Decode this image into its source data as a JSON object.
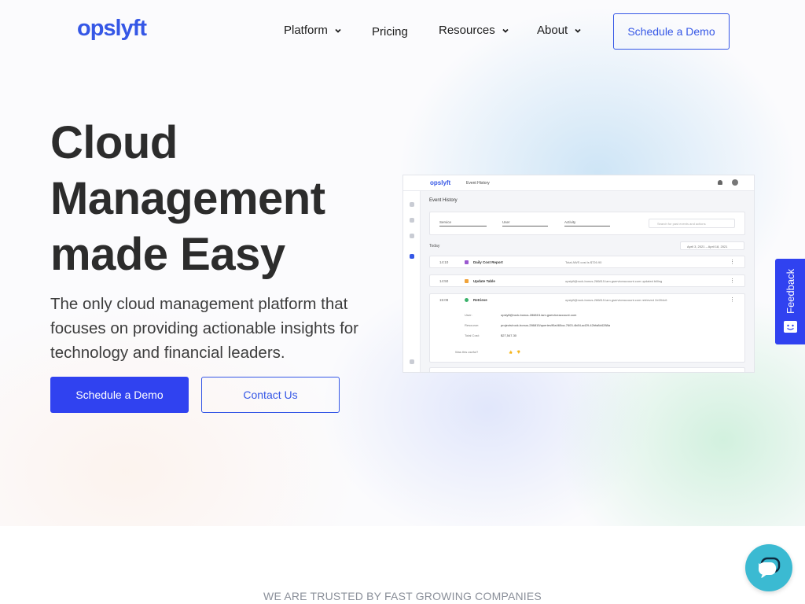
{
  "brand": {
    "logo": "opslyft",
    "accent": "#3557e6",
    "primary_button": "#3042f0"
  },
  "nav": {
    "items": [
      {
        "label": "Platform",
        "has_dropdown": true
      },
      {
        "label": "Pricing",
        "has_dropdown": false
      },
      {
        "label": "Resources",
        "has_dropdown": true
      },
      {
        "label": "About",
        "has_dropdown": true
      }
    ],
    "cta": "Schedule a Demo"
  },
  "hero": {
    "title_lines": [
      "Cloud",
      "Management",
      "made Easy"
    ],
    "subtitle": "The only cloud management platform that focuses on providing actionable insights for technology and financial leaders.",
    "primary_cta": "Schedule a Demo",
    "secondary_cta": "Contact Us"
  },
  "mockup": {
    "logo": "opslyft",
    "breadcrumb": "Event History",
    "heading": "Event History",
    "filters": [
      "Service",
      "User",
      "Activity"
    ],
    "search_placeholder": "Search for past events and actions",
    "section": "Today",
    "date_range": "April 3, 2021 – April 18, 2021",
    "rows": [
      {
        "time": "14:10",
        "name": "Daily Cost Report",
        "desc": "Total AWS cost is $726.90",
        "color": "#9b59d0"
      },
      {
        "time": "14:50",
        "name": "Update Table",
        "desc": "opslyft@rock-bonus-286815.iam.gserviceaccount.com updated billing",
        "color": "#f0a33a"
      },
      {
        "time": "15:08",
        "name": "Retrieve",
        "desc": "opslyft@rock-bonus-286815.iam.gserviceaccount.com retrieved 2e094c6",
        "color": "#3bb26b"
      }
    ],
    "detail": {
      "user_label": "User:",
      "user_value": "opslyft@rock-bonus-286815.iam.gserviceaccount.com",
      "resource_label": "Resource:",
      "resource_value": "projects/rock-bonus-286815/queries/f0a460ca-7603-4b84-ad29-42bfa8d4288a",
      "cost_label": "Total Cost:",
      "cost_value": "$27,547.30",
      "useful_label": "Was this useful?"
    }
  },
  "feedback": {
    "label": "Feedback"
  },
  "trusted": {
    "label": "WE ARE TRUSTED BY FAST GROWING COMPANIES"
  }
}
